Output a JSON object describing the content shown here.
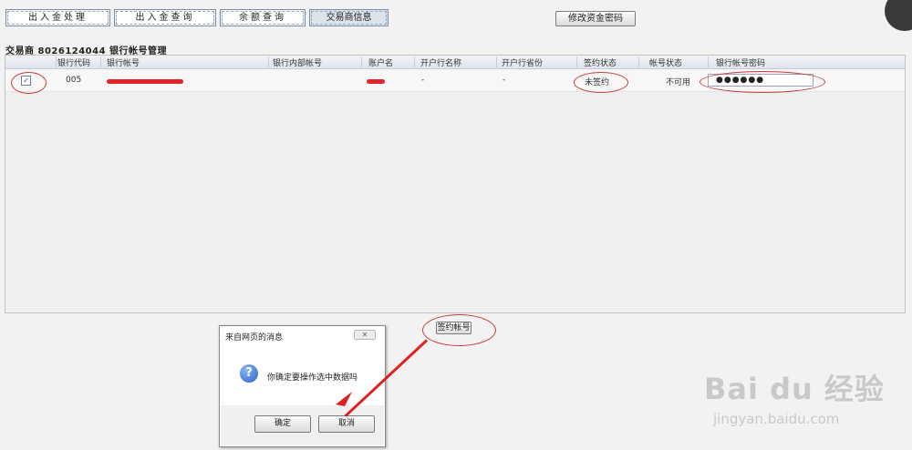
{
  "tabs": [
    {
      "label": "出入金处理",
      "active": false
    },
    {
      "label": "出入金查询",
      "active": false
    },
    {
      "label": "余额查询",
      "active": false
    },
    {
      "label": "交易商信息",
      "active": true
    }
  ],
  "change_password_button": "修改资金密码",
  "section_title": "交易商 8026124044 银行帐号管理",
  "grid": {
    "headers": [
      "银行代码",
      "银行帐号",
      "银行内部帐号",
      "账户名",
      "开户行名称",
      "开户行省份",
      "签约状态",
      "帐号状态",
      "银行帐号密码"
    ],
    "row": {
      "checked": true,
      "bank_code": "005",
      "bank_name": "-",
      "bank_province": "-",
      "sign_status": "未签约",
      "account_status": "不可用",
      "password": "●●●●●●"
    }
  },
  "sign_account_button": "签约帐号",
  "dialog": {
    "title": "来自网页的消息",
    "close_icon": "close-icon",
    "message": "你确定要操作选中数据吗",
    "ok_label": "确定",
    "cancel_label": "取消"
  },
  "watermark": {
    "brand": "Bai du 经验",
    "url": "jingyan.baidu.com"
  },
  "annotation_color": "#d03a3a",
  "arrow_color": "#e02020"
}
